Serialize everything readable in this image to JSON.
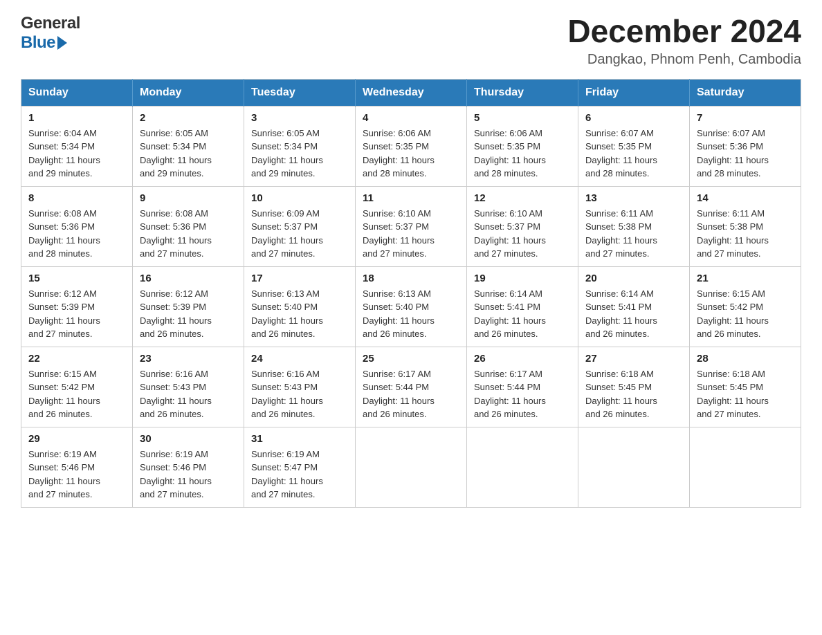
{
  "header": {
    "logo_general": "General",
    "logo_blue": "Blue",
    "title": "December 2024",
    "location": "Dangkao, Phnom Penh, Cambodia"
  },
  "days_of_week": [
    "Sunday",
    "Monday",
    "Tuesday",
    "Wednesday",
    "Thursday",
    "Friday",
    "Saturday"
  ],
  "weeks": [
    [
      {
        "day": "1",
        "sunrise": "6:04 AM",
        "sunset": "5:34 PM",
        "daylight": "11 hours and 29 minutes."
      },
      {
        "day": "2",
        "sunrise": "6:05 AM",
        "sunset": "5:34 PM",
        "daylight": "11 hours and 29 minutes."
      },
      {
        "day": "3",
        "sunrise": "6:05 AM",
        "sunset": "5:34 PM",
        "daylight": "11 hours and 29 minutes."
      },
      {
        "day": "4",
        "sunrise": "6:06 AM",
        "sunset": "5:35 PM",
        "daylight": "11 hours and 28 minutes."
      },
      {
        "day": "5",
        "sunrise": "6:06 AM",
        "sunset": "5:35 PM",
        "daylight": "11 hours and 28 minutes."
      },
      {
        "day": "6",
        "sunrise": "6:07 AM",
        "sunset": "5:35 PM",
        "daylight": "11 hours and 28 minutes."
      },
      {
        "day": "7",
        "sunrise": "6:07 AM",
        "sunset": "5:36 PM",
        "daylight": "11 hours and 28 minutes."
      }
    ],
    [
      {
        "day": "8",
        "sunrise": "6:08 AM",
        "sunset": "5:36 PM",
        "daylight": "11 hours and 28 minutes."
      },
      {
        "day": "9",
        "sunrise": "6:08 AM",
        "sunset": "5:36 PM",
        "daylight": "11 hours and 27 minutes."
      },
      {
        "day": "10",
        "sunrise": "6:09 AM",
        "sunset": "5:37 PM",
        "daylight": "11 hours and 27 minutes."
      },
      {
        "day": "11",
        "sunrise": "6:10 AM",
        "sunset": "5:37 PM",
        "daylight": "11 hours and 27 minutes."
      },
      {
        "day": "12",
        "sunrise": "6:10 AM",
        "sunset": "5:37 PM",
        "daylight": "11 hours and 27 minutes."
      },
      {
        "day": "13",
        "sunrise": "6:11 AM",
        "sunset": "5:38 PM",
        "daylight": "11 hours and 27 minutes."
      },
      {
        "day": "14",
        "sunrise": "6:11 AM",
        "sunset": "5:38 PM",
        "daylight": "11 hours and 27 minutes."
      }
    ],
    [
      {
        "day": "15",
        "sunrise": "6:12 AM",
        "sunset": "5:39 PM",
        "daylight": "11 hours and 27 minutes."
      },
      {
        "day": "16",
        "sunrise": "6:12 AM",
        "sunset": "5:39 PM",
        "daylight": "11 hours and 26 minutes."
      },
      {
        "day": "17",
        "sunrise": "6:13 AM",
        "sunset": "5:40 PM",
        "daylight": "11 hours and 26 minutes."
      },
      {
        "day": "18",
        "sunrise": "6:13 AM",
        "sunset": "5:40 PM",
        "daylight": "11 hours and 26 minutes."
      },
      {
        "day": "19",
        "sunrise": "6:14 AM",
        "sunset": "5:41 PM",
        "daylight": "11 hours and 26 minutes."
      },
      {
        "day": "20",
        "sunrise": "6:14 AM",
        "sunset": "5:41 PM",
        "daylight": "11 hours and 26 minutes."
      },
      {
        "day": "21",
        "sunrise": "6:15 AM",
        "sunset": "5:42 PM",
        "daylight": "11 hours and 26 minutes."
      }
    ],
    [
      {
        "day": "22",
        "sunrise": "6:15 AM",
        "sunset": "5:42 PM",
        "daylight": "11 hours and 26 minutes."
      },
      {
        "day": "23",
        "sunrise": "6:16 AM",
        "sunset": "5:43 PM",
        "daylight": "11 hours and 26 minutes."
      },
      {
        "day": "24",
        "sunrise": "6:16 AM",
        "sunset": "5:43 PM",
        "daylight": "11 hours and 26 minutes."
      },
      {
        "day": "25",
        "sunrise": "6:17 AM",
        "sunset": "5:44 PM",
        "daylight": "11 hours and 26 minutes."
      },
      {
        "day": "26",
        "sunrise": "6:17 AM",
        "sunset": "5:44 PM",
        "daylight": "11 hours and 26 minutes."
      },
      {
        "day": "27",
        "sunrise": "6:18 AM",
        "sunset": "5:45 PM",
        "daylight": "11 hours and 26 minutes."
      },
      {
        "day": "28",
        "sunrise": "6:18 AM",
        "sunset": "5:45 PM",
        "daylight": "11 hours and 27 minutes."
      }
    ],
    [
      {
        "day": "29",
        "sunrise": "6:19 AM",
        "sunset": "5:46 PM",
        "daylight": "11 hours and 27 minutes."
      },
      {
        "day": "30",
        "sunrise": "6:19 AM",
        "sunset": "5:46 PM",
        "daylight": "11 hours and 27 minutes."
      },
      {
        "day": "31",
        "sunrise": "6:19 AM",
        "sunset": "5:47 PM",
        "daylight": "11 hours and 27 minutes."
      },
      null,
      null,
      null,
      null
    ]
  ],
  "sunrise_label": "Sunrise:",
  "sunset_label": "Sunset:",
  "daylight_label": "Daylight:"
}
